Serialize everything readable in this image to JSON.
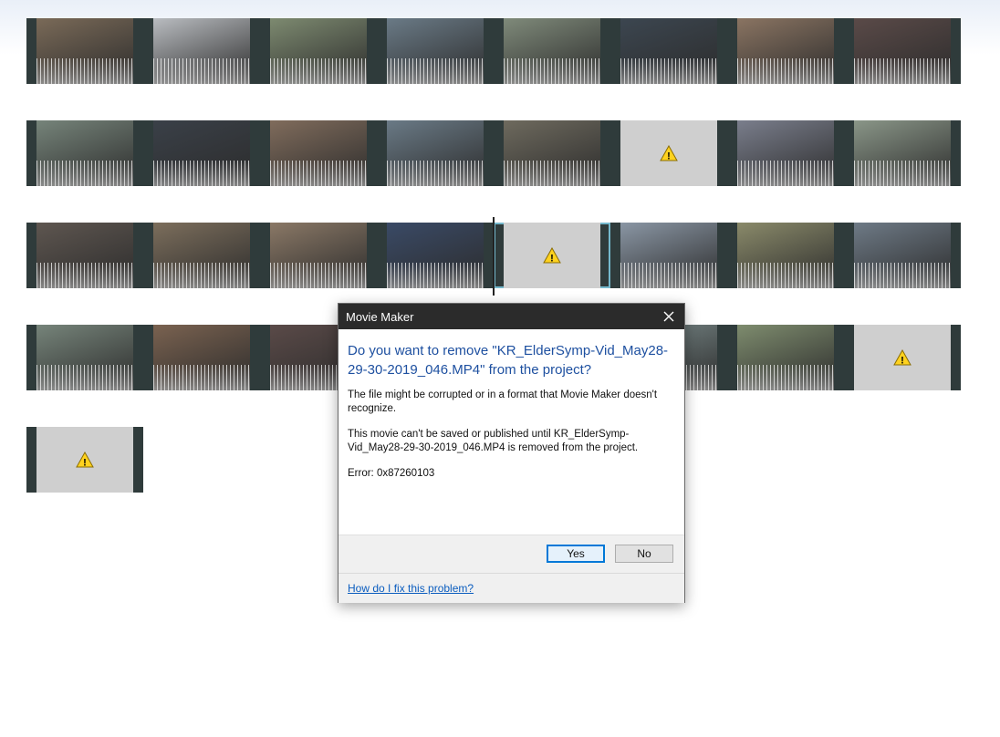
{
  "dialog": {
    "title": "Movie Maker",
    "close_glyph": "✕",
    "heading": "Do you want to remove \"KR_ElderSymp-Vid_May28-29-30-2019_046.MP4\" from the project?",
    "paragraph1": "The file might be corrupted or in a format that Movie Maker doesn't recognize.",
    "paragraph2": "This movie can't be saved or published until KR_ElderSymp-Vid_May28-29-30-2019_046.MP4 is removed from the project.",
    "error": "Error: 0x87260103",
    "yes_label": "Yes",
    "no_label": "No",
    "help_link": "How do I fix this problem?"
  },
  "storyboard": {
    "rows": [
      {
        "clips": [
          {
            "status": "ok",
            "color": "#7a6a58"
          },
          {
            "status": "ok",
            "color": "#b9bcc0"
          },
          {
            "status": "ok",
            "color": "#7d8a70"
          },
          {
            "status": "ok",
            "color": "#6a7a86"
          },
          {
            "status": "ok",
            "color": "#7f8a7a"
          },
          {
            "status": "ok",
            "color": "#3c4650"
          },
          {
            "status": "ok",
            "color": "#8a7462"
          },
          {
            "status": "ok",
            "color": "#5a4a48"
          }
        ]
      },
      {
        "clips": [
          {
            "status": "ok",
            "color": "#76847a"
          },
          {
            "status": "ok",
            "color": "#3a4048"
          },
          {
            "status": "ok",
            "color": "#806c5c"
          },
          {
            "status": "ok",
            "color": "#6a7a86"
          },
          {
            "status": "ok",
            "color": "#6e6a5e"
          },
          {
            "status": "missing",
            "color": "#cfcfcf"
          },
          {
            "status": "ok",
            "color": "#7a7e8c"
          },
          {
            "status": "ok",
            "color": "#8a9688"
          }
        ]
      },
      {
        "clips": [
          {
            "status": "ok",
            "color": "#5e5650"
          },
          {
            "status": "ok",
            "color": "#7c6e5c"
          },
          {
            "status": "ok",
            "color": "#8a7866"
          },
          {
            "status": "ok",
            "color": "#3a4a66"
          },
          {
            "status": "missing",
            "selected": true,
            "color": "#cfcfcf"
          },
          {
            "status": "ok",
            "color": "#8a96a4"
          },
          {
            "status": "ok",
            "color": "#8a8a6a"
          },
          {
            "status": "ok",
            "color": "#6e7a86"
          }
        ]
      },
      {
        "clips": [
          {
            "status": "ok",
            "color": "#76847a"
          },
          {
            "status": "ok",
            "color": "#7a6250"
          },
          {
            "status": "ok",
            "color": "#5a4a48"
          },
          {
            "status": "ok",
            "color": "#6e7a70"
          },
          {
            "status": "ok",
            "color": "#7e8a7a"
          },
          {
            "status": "ok",
            "color": "#7a8a8a"
          },
          {
            "status": "ok",
            "color": "#7e8c6e"
          },
          {
            "status": "missing",
            "color": "#cfcfcf"
          }
        ]
      },
      {
        "clips": [
          {
            "status": "missing",
            "color": "#cfcfcf"
          }
        ]
      }
    ]
  },
  "icons": {
    "warning": "warning-icon",
    "close": "close-icon"
  }
}
